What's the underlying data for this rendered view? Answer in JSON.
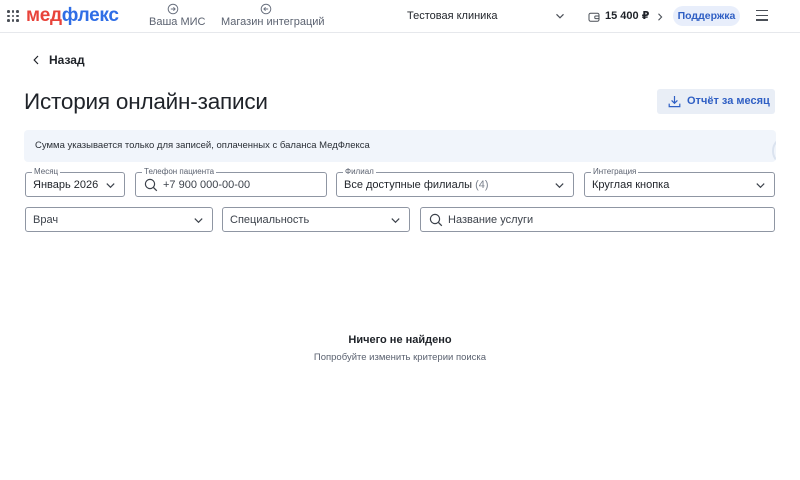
{
  "header": {
    "logo": {
      "part1": "мед",
      "part2": "флекс"
    },
    "nav": [
      {
        "label": "Ваша МИС",
        "icon": "arrow-circle-right-icon"
      },
      {
        "label": "Магазин интеграций",
        "icon": "arrow-circle-left-icon"
      }
    ],
    "clinic": "Тестовая клиника",
    "balance": "15 400 ₽",
    "support_label": "Поддержка"
  },
  "page": {
    "back_label": "Назад",
    "title": "История онлайн-записи",
    "report_button": "Отчёт за месяц",
    "info_text": "Сумма указывается только для записей, оплаченных с баланса МедФлекса"
  },
  "filters": {
    "month": {
      "label": "Месяц",
      "value": "Январь 2026"
    },
    "phone": {
      "label": "Телефон пациента",
      "placeholder": "+7 900 000-00-00"
    },
    "branch": {
      "label": "Филиал",
      "value": "Все доступные филиалы",
      "count": "(4)"
    },
    "integration": {
      "label": "Интеграция",
      "value": "Круглая кнопка"
    },
    "doctor": {
      "placeholder": "Врач"
    },
    "specialty": {
      "placeholder": "Специальность"
    },
    "service": {
      "placeholder": "Название услуги"
    }
  },
  "empty_state": {
    "title": "Ничего не найдено",
    "subtitle": "Попробуйте изменить критерии поиска"
  },
  "colors": {
    "logo_red": "#e8433a",
    "logo_blue": "#2f6ee6",
    "accent": "#2f5fc4",
    "info_bg": "#f1f5fb"
  }
}
